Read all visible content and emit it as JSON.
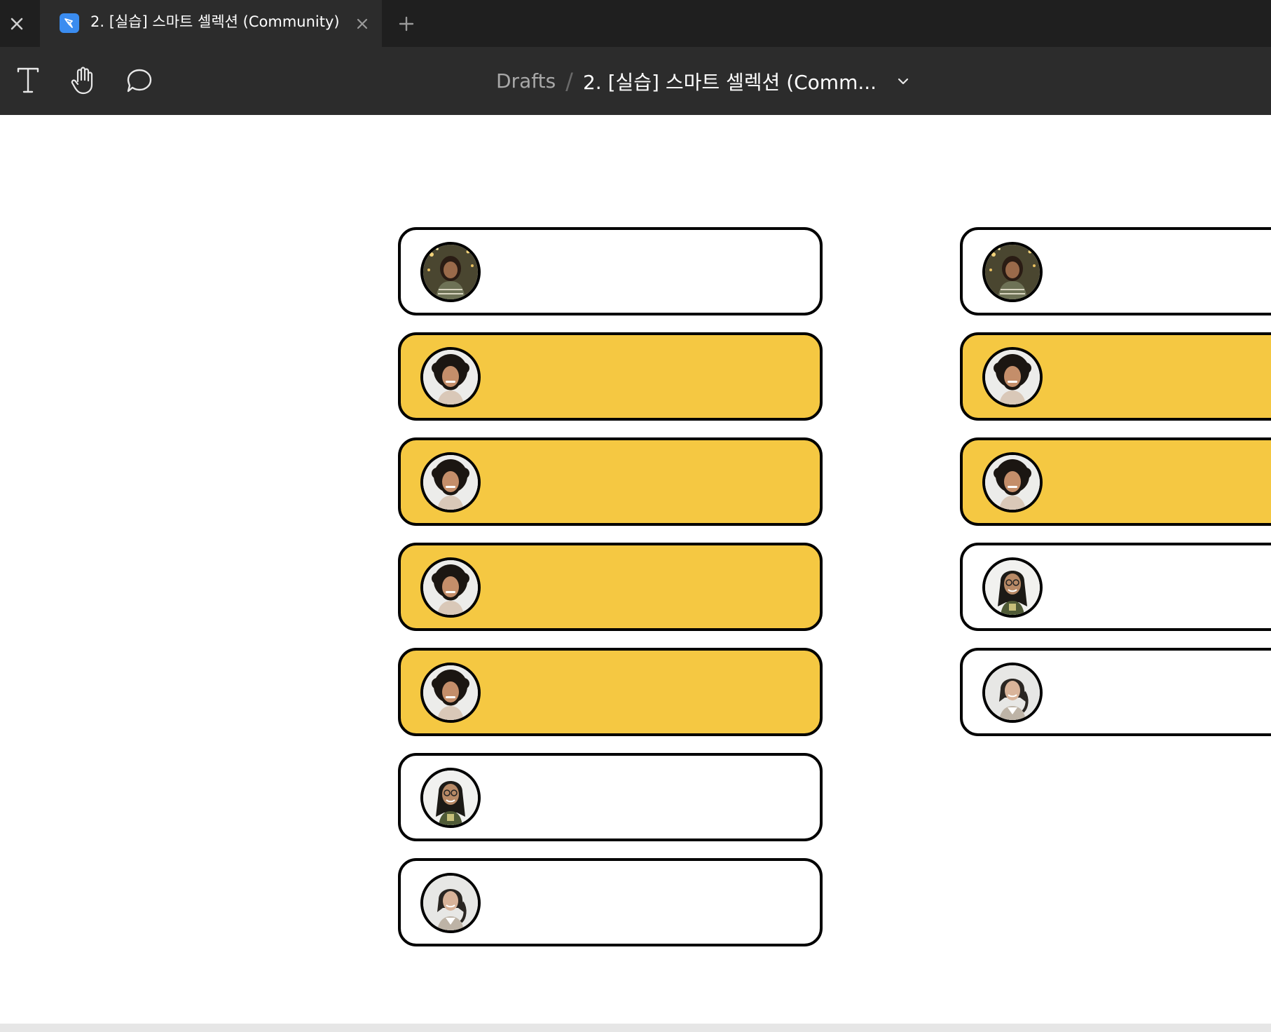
{
  "tabs": {
    "close_left_icon": "close-icon",
    "active": {
      "title": "2. [실습] 스마트 셀렉션 (Community)",
      "icon": "figma-file-icon",
      "close_icon": "close-icon"
    },
    "add_icon": "plus-icon"
  },
  "toolbar": {
    "tools": [
      "text-tool-icon",
      "hand-tool-icon",
      "comment-tool-icon"
    ],
    "breadcrumb": {
      "root": "Drafts",
      "separator": "/",
      "file": "2. [실습] 스마트 셀렉션 (Comm...",
      "chevron": "chevron-down-icon"
    }
  },
  "colors": {
    "tabbar": "#1f1f1f",
    "toolbar": "#2c2c2c",
    "card_yellow": "#f5c842",
    "card_white": "#ffffff",
    "file_icon": "#3a8cf0"
  },
  "canvas": {
    "columns": [
      {
        "cards": [
          {
            "fill": "white",
            "avatar": "woman-with-lights"
          },
          {
            "fill": "yellow",
            "avatar": "curly-hair-man"
          },
          {
            "fill": "yellow",
            "avatar": "curly-hair-man"
          },
          {
            "fill": "yellow",
            "avatar": "curly-hair-man"
          },
          {
            "fill": "yellow",
            "avatar": "curly-hair-man"
          },
          {
            "fill": "white",
            "avatar": "man-with-glasses-long-hair"
          },
          {
            "fill": "white",
            "avatar": "woman-smiling"
          }
        ]
      },
      {
        "cards": [
          {
            "fill": "white",
            "avatar": "woman-with-lights"
          },
          {
            "fill": "yellow",
            "avatar": "curly-hair-man"
          },
          {
            "fill": "yellow",
            "avatar": "curly-hair-man"
          },
          {
            "fill": "white",
            "avatar": "man-with-glasses-long-hair"
          },
          {
            "fill": "white",
            "avatar": "woman-smiling"
          }
        ]
      }
    ]
  }
}
